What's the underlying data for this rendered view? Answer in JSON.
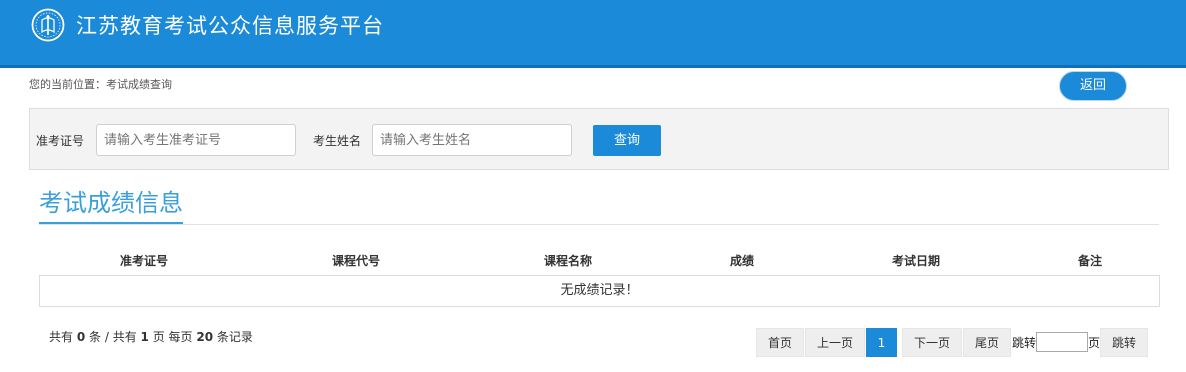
{
  "header": {
    "site_title": "江苏教育考试公众信息服务平台",
    "logo_icon": "exam-seal-icon",
    "background": "#1b8ad8"
  },
  "breadcrumb": {
    "text": "您的当前位置：考试成绩查询"
  },
  "back_button": {
    "label": "返回"
  },
  "search": {
    "ticket_label": "准考证号",
    "ticket_placeholder": "请输入考生准考证号",
    "name_label": "考生姓名",
    "name_placeholder": "请输入考生姓名",
    "query_label": "查询"
  },
  "section": {
    "title": "考试成绩信息"
  },
  "table": {
    "columns": [
      "准考证号",
      "课程代号",
      "课程名称",
      "成绩",
      "考试日期",
      "备注"
    ],
    "empty_message": "无成绩记录！"
  },
  "summary": {
    "prefix": "共有",
    "total": "0",
    "unit1": "条 / 共有",
    "pages": "1",
    "unit2": "页 每页",
    "per_page": "20",
    "unit3": "条记录"
  },
  "pagination": {
    "first": "首页",
    "prev": "上一页",
    "current": "1",
    "next": "下一页",
    "last": "尾页",
    "jump_prefix": "跳转",
    "jump_suffix": "页",
    "jump_button": "跳转"
  },
  "colors": {
    "accent": "#1b8ad8",
    "title_blue": "#3aa0db"
  }
}
